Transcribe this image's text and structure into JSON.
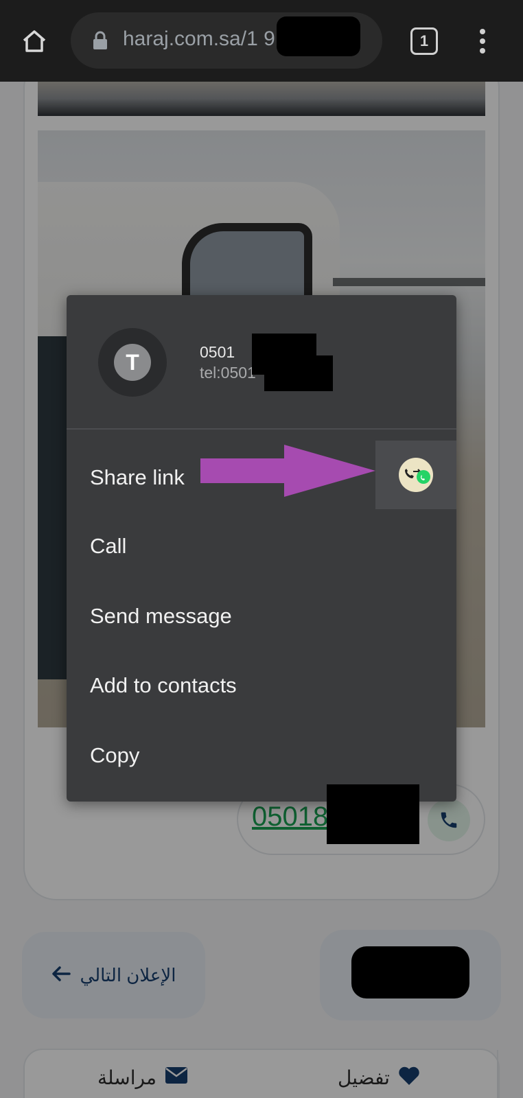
{
  "browser": {
    "url": "haraj.com.sa/1          9!",
    "tab_count": "1"
  },
  "contact_sheet": {
    "avatar_letter": "T",
    "number": "0501",
    "uri": "tel:0501",
    "actions": [
      {
        "label": "Share link"
      },
      {
        "label": "Call"
      },
      {
        "label": "Send message"
      },
      {
        "label": "Add to contacts"
      },
      {
        "label": "Copy"
      }
    ]
  },
  "page": {
    "phone_number": "05018",
    "next_ad_label": "الإعلان التالي",
    "bottom": {
      "message_label": "مراسلة",
      "favorite_label": "تفضيل"
    }
  },
  "colors": {
    "annotation_arrow": "#a64bb0",
    "phone_green": "#1aa053",
    "accent_navy": "#173e6e"
  }
}
